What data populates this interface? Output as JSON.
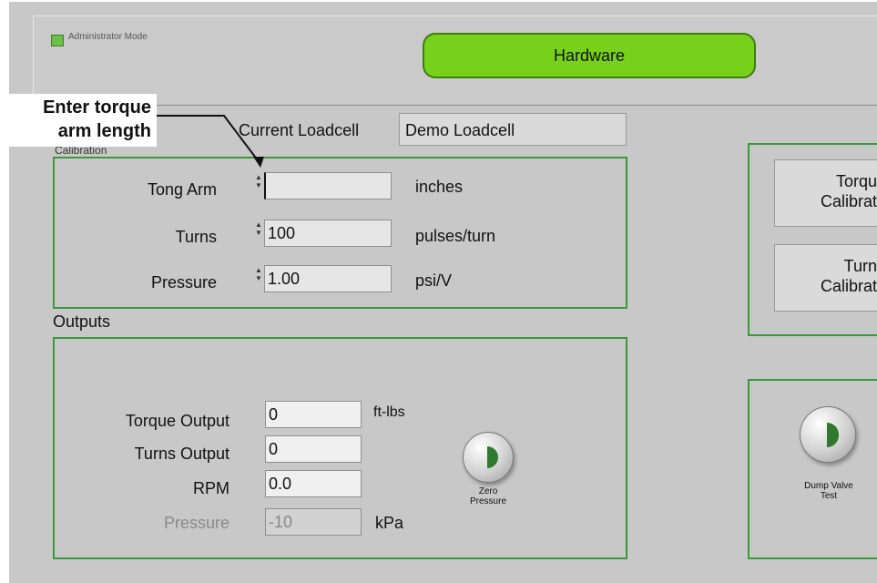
{
  "header": {
    "admin_mode_label": "Administrator Mode",
    "hardware_button": "Hardware"
  },
  "callout": {
    "line1": "Enter torque",
    "line2": "arm length"
  },
  "calibration": {
    "section_title": "Calibration",
    "current_loadcell_label": "Current Loadcell",
    "current_loadcell_value": "Demo Loadcell",
    "rows": [
      {
        "label": "Tong Arm",
        "value": "",
        "unit": "inches"
      },
      {
        "label": "Turns",
        "value": "100",
        "unit": "pulses/turn"
      },
      {
        "label": "Pressure",
        "value": "1.00",
        "unit": "psi/V"
      }
    ]
  },
  "outputs": {
    "section_title": "Outputs",
    "rows": [
      {
        "label": "Torque Output",
        "value": "0",
        "unit": "ft-lbs"
      },
      {
        "label": "Turns Output",
        "value": "0",
        "unit": ""
      },
      {
        "label": "RPM",
        "value": "0.0",
        "unit": ""
      },
      {
        "label": "Pressure",
        "value": "-10",
        "unit": "kPa"
      }
    ],
    "zero_pressure_label_1": "Zero",
    "zero_pressure_label_2": "Pressure"
  },
  "side_panel": {
    "torque_calibration_1": "Torqu",
    "torque_calibration_2": "Calibrat",
    "turns_calibration_1": "Turn",
    "turns_calibration_2": "Calibrat",
    "dump_valve_1": "Dump Valve",
    "dump_valve_2": "Test"
  },
  "colors": {
    "accent_green": "#77d11b",
    "frame_green": "#3a9a3a",
    "panel_gray": "#c8c8c8"
  }
}
